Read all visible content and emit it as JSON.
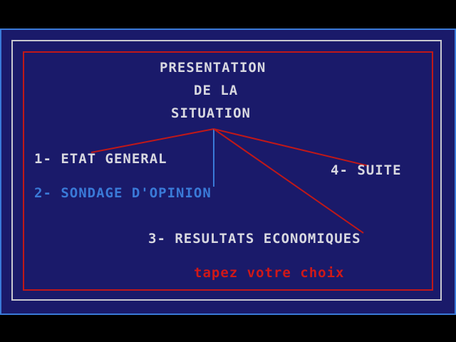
{
  "title": {
    "line1": "PRESENTATION",
    "line2": "DE LA",
    "line3": "SITUATION"
  },
  "menu": {
    "items": [
      {
        "label": "1- ETAT GENERAL"
      },
      {
        "label": "2- SONDAGE D'OPINION"
      },
      {
        "label": "3- RESULTATS ECONOMIQUES"
      },
      {
        "label": "4- SUITE"
      }
    ],
    "selected_index": 1
  },
  "prompt": "tapez votre choix",
  "colors": {
    "background": "#1a1a6a",
    "text": "#d8d8e0",
    "selected": "#3a7ad8",
    "accent": "#d01818"
  }
}
